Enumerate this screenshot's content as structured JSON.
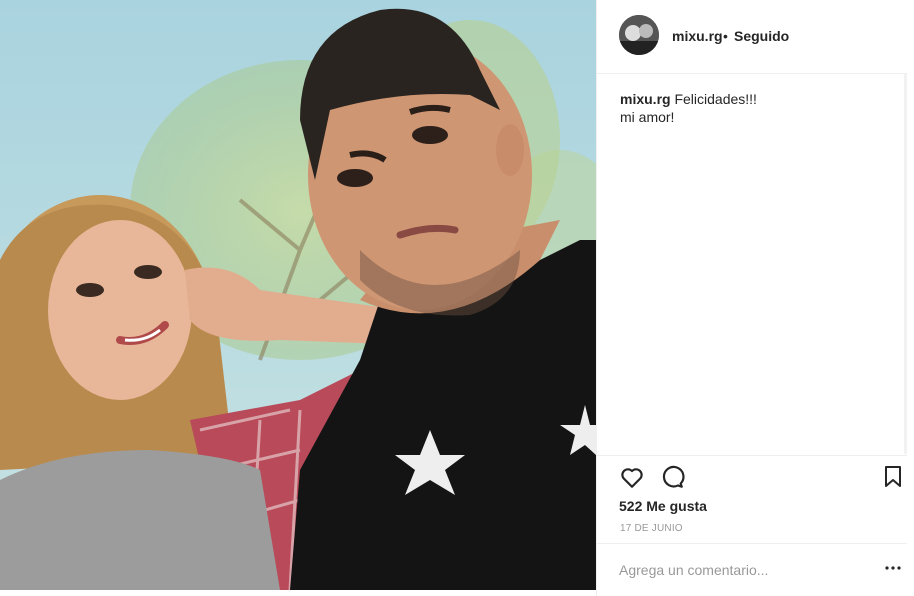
{
  "post": {
    "author": "mixu.rg",
    "separator": "•",
    "follow_status": "Seguido",
    "caption_user": "mixu.rg",
    "caption_line1": "Felicidades!!!",
    "caption_line2": "mi amor!",
    "likes": "522 Me gusta",
    "date": "17 DE JUNIO"
  },
  "comment": {
    "placeholder": "Agrega un comentario..."
  },
  "icons": {
    "like": "heart-icon",
    "comment": "comment-bubble-icon",
    "save": "bookmark-icon",
    "more": "more-options-icon"
  },
  "colors": {
    "text": "#262626",
    "muted": "#999999",
    "border": "#efefef"
  }
}
